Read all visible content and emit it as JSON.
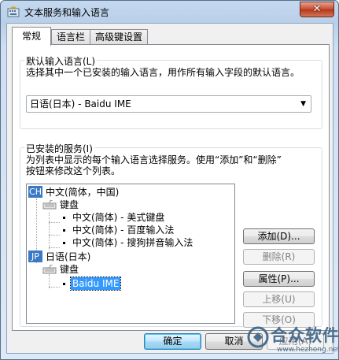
{
  "window": {
    "title": "文本服务和输入语言",
    "close_glyph": "✕"
  },
  "tabs": [
    {
      "label": "常规",
      "active": true
    },
    {
      "label": "语言栏",
      "active": false
    },
    {
      "label": "高级键设置",
      "active": false
    }
  ],
  "default_language": {
    "group_label": "默认输入语言(L)",
    "description": "选择其中一个已安装的输入语言，用作所有输入字段的默认语言。",
    "selected": "日语(日本) - Baidu IME"
  },
  "installed_services": {
    "group_label": "已安装的服务(I)",
    "description_line1": "为列表中显示的每个输入语言选择服务。使用“添加”和“删除”",
    "description_line2": "按钮来修改这个列表。",
    "tree": {
      "lang1": {
        "badge": "CH",
        "label": "中文(简体，中国)",
        "category": "键盘",
        "services": [
          "中文(简体) - 美式键盘",
          "中文(简体) - 百度输入法",
          "中文(简体) - 搜狗拼音输入法"
        ]
      },
      "lang2": {
        "badge": "JP",
        "label": "日语(日本)",
        "category": "键盘",
        "services": [
          "Baidu IME"
        ]
      }
    },
    "buttons": {
      "add": {
        "label": "添加(D)...",
        "enabled": true
      },
      "remove": {
        "label": "删除(R)",
        "enabled": false
      },
      "properties": {
        "label": "属性(P)...",
        "enabled": true
      },
      "move_up": {
        "label": "上移(U)",
        "enabled": false
      },
      "move_down": {
        "label": "下移(O)",
        "enabled": false
      }
    }
  },
  "footer": {
    "ok": "确定",
    "cancel": "取消",
    "apply": "应用(A)"
  },
  "watermark": {
    "text": "合众软件园",
    "url": "www.hezhong.net"
  },
  "colors": {
    "selection": "#3399ff",
    "badge": "#3b79c4",
    "close_button": "#c7482b"
  },
  "icons": [
    "window-icon",
    "close-icon",
    "keyboard-icon",
    "chevron-down-icon"
  ]
}
